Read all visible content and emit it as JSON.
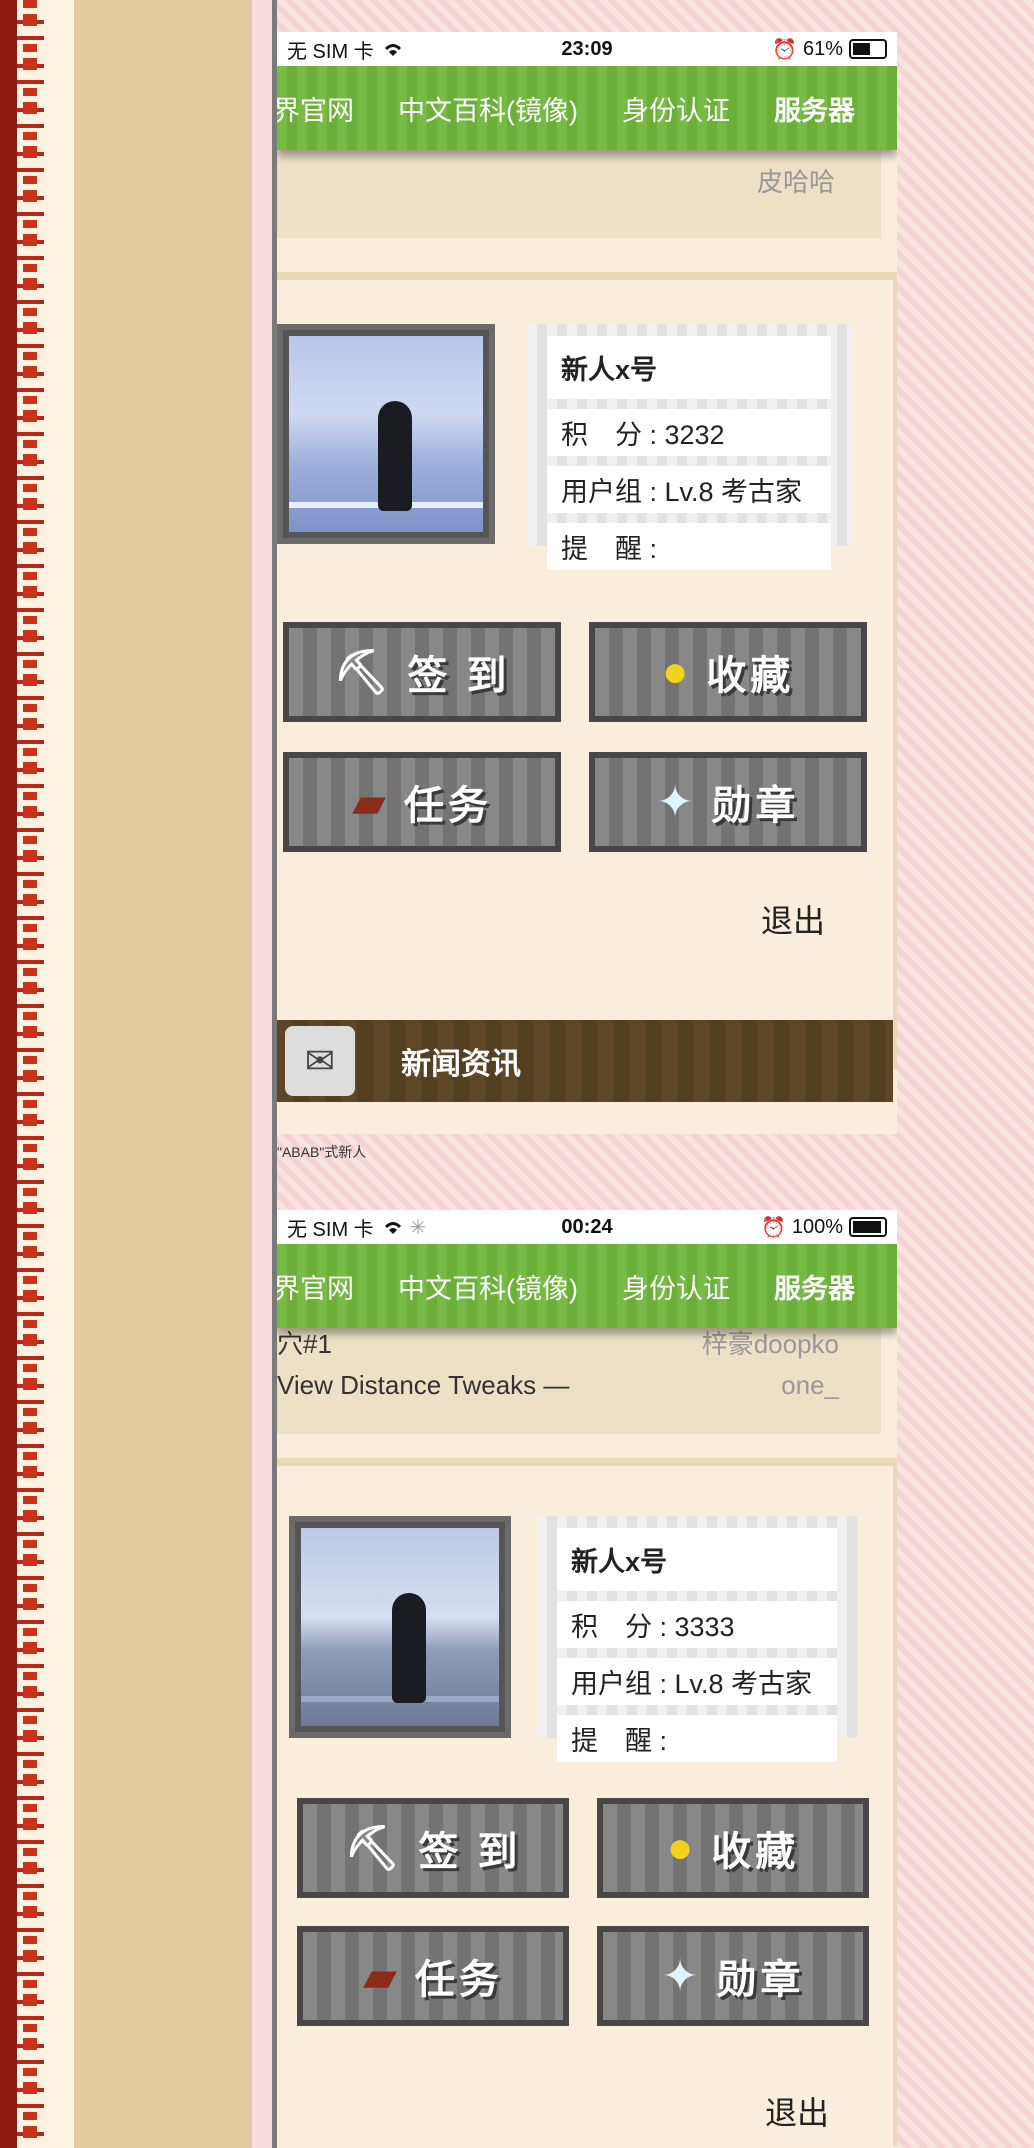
{
  "screens": [
    {
      "status": {
        "carrier": "无 SIM 卡",
        "time": "23:09",
        "battery": "61%",
        "battery_level": 0.61
      },
      "nav": [
        "界官网",
        "中文百科(镜像)",
        "身份认证",
        "服务器"
      ],
      "prev": {
        "line2": "皮哈哈"
      },
      "profile": {
        "name": "新人x号",
        "points": "积　分 : 3232",
        "group": "用户组 : Lv.8 考古家",
        "remind": "提　醒 :"
      },
      "buttons": {
        "signin": "签 到",
        "favorite": "收藏",
        "tasks": "任务",
        "medals": "勋章"
      },
      "logout": "退出",
      "news": "新闻资讯"
    },
    {
      "status": {
        "carrier": "无 SIM 卡",
        "time": "00:24",
        "battery": "100%",
        "battery_level": 1.0
      },
      "nav": [
        "界官网",
        "中文百科(镜像)",
        "身份认证",
        "服务器"
      ],
      "prev": {
        "line1_left": "穴#1",
        "line1_right": "梓豪doopko",
        "line2_left": "View Distance Tweaks —",
        "line2_right": "one_"
      },
      "profile": {
        "name": "新人x号",
        "points": "积　分 : 3333",
        "group": "用户组 : Lv.8 考古家",
        "remind": "提　醒 :"
      },
      "buttons": {
        "signin": "签 到",
        "favorite": "收藏",
        "tasks": "任务",
        "medals": "勋章"
      },
      "logout": "退出"
    }
  ],
  "caption": "\"ABAB\"式新人",
  "icons": {
    "pickaxe": "pickaxe-icon",
    "apple": "golden-apple-icon",
    "book": "book-icon",
    "star": "nether-star-icon",
    "news": "scroll-icon"
  }
}
